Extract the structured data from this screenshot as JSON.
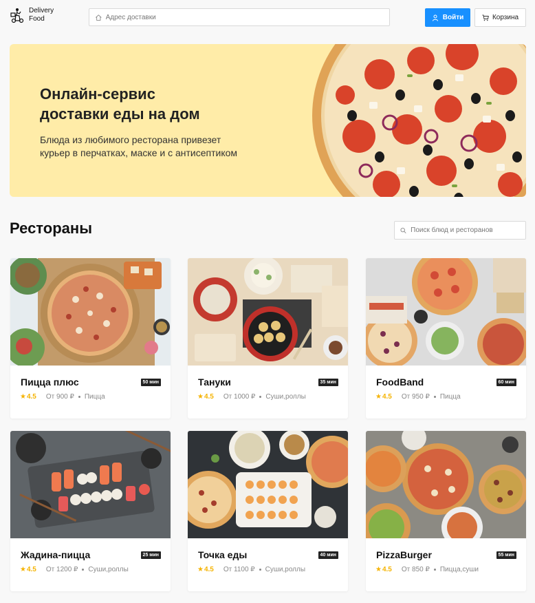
{
  "header": {
    "logo_line1": "Delivery",
    "logo_line2": "Food",
    "address_placeholder": "Адрес доставки",
    "login_label": "Войти",
    "cart_label": "Корзина",
    "accent": "#1890ff"
  },
  "promo": {
    "title": "Онлайн-сервис\nдоставки еды на дом",
    "text": "Блюда из любимого ресторана привезет\nкурьер в перчатках, маске и с антисептиком",
    "background": "#ffeca8"
  },
  "restaurants": {
    "title": "Рестораны",
    "search_placeholder": "Поиск блюд и ресторанов",
    "cards": [
      {
        "name": "Пицца плюс",
        "time": "50 мин",
        "rating": "4.5",
        "price": "От 900 ₽",
        "category": "Пицца",
        "image": "pizza-platter"
      },
      {
        "name": "Тануки",
        "time": "35 мин",
        "rating": "4.5",
        "price": "От 1000 ₽",
        "category": "Суши,роллы",
        "image": "asian-dishes"
      },
      {
        "name": "FoodBand",
        "time": "60 мин",
        "rating": "4.5",
        "price": "От 950 ₽",
        "category": "Пицца",
        "image": "pizza-mix"
      },
      {
        "name": "Жадина-пицца",
        "time": "25 мин",
        "rating": "4.5",
        "price": "От 1200 ₽",
        "category": "Суши,роллы",
        "image": "sushi-board"
      },
      {
        "name": "Точка еды",
        "time": "40 мин",
        "rating": "4.5",
        "price": "От 1100 ₽",
        "category": "Суши,роллы",
        "image": "sushi-and-pizza"
      },
      {
        "name": "PizzaBurger",
        "time": "55 мин",
        "rating": "4.5",
        "price": "От 850 ₽",
        "category": "Пицца,суши",
        "image": "pizza-set"
      }
    ]
  }
}
